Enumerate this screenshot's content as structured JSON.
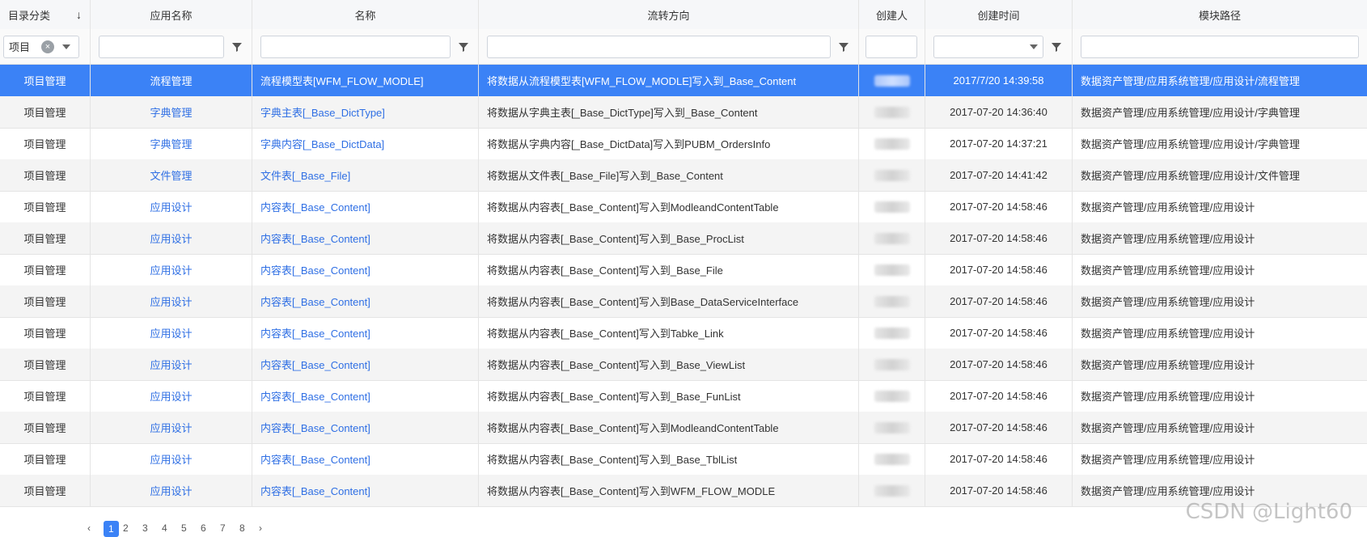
{
  "columns": [
    "目录分类",
    "应用名称",
    "名称",
    "流转方向",
    "创建人",
    "创建时间",
    "模块路径"
  ],
  "filters": {
    "category_tag": "项目",
    "clear_symbol": "×"
  },
  "rows": [
    {
      "cat": "项目管理",
      "app": "流程管理",
      "name": "流程模型表[WFM_FLOW_MODLE]",
      "flow": "将数据从流程模型表[WFM_FLOW_MODLE]写入到_Base_Content",
      "time": "2017/7/20 14:39:58",
      "path": "数据资产管理/应用系统管理/应用设计/流程管理"
    },
    {
      "cat": "项目管理",
      "app": "字典管理",
      "name": "字典主表[_Base_DictType]",
      "flow": "将数据从字典主表[_Base_DictType]写入到_Base_Content",
      "time": "2017-07-20 14:36:40",
      "path": "数据资产管理/应用系统管理/应用设计/字典管理"
    },
    {
      "cat": "项目管理",
      "app": "字典管理",
      "name": "字典内容[_Base_DictData]",
      "flow": "将数据从字典内容[_Base_DictData]写入到PUBM_OrdersInfo",
      "time": "2017-07-20 14:37:21",
      "path": "数据资产管理/应用系统管理/应用设计/字典管理"
    },
    {
      "cat": "项目管理",
      "app": "文件管理",
      "name": "文件表[_Base_File]",
      "flow": "将数据从文件表[_Base_File]写入到_Base_Content",
      "time": "2017-07-20 14:41:42",
      "path": "数据资产管理/应用系统管理/应用设计/文件管理"
    },
    {
      "cat": "项目管理",
      "app": "应用设计",
      "name": "内容表[_Base_Content]",
      "flow": "将数据从内容表[_Base_Content]写入到ModleandContentTable",
      "time": "2017-07-20 14:58:46",
      "path": "数据资产管理/应用系统管理/应用设计"
    },
    {
      "cat": "项目管理",
      "app": "应用设计",
      "name": "内容表[_Base_Content]",
      "flow": "将数据从内容表[_Base_Content]写入到_Base_ProcList",
      "time": "2017-07-20 14:58:46",
      "path": "数据资产管理/应用系统管理/应用设计"
    },
    {
      "cat": "项目管理",
      "app": "应用设计",
      "name": "内容表[_Base_Content]",
      "flow": "将数据从内容表[_Base_Content]写入到_Base_File",
      "time": "2017-07-20 14:58:46",
      "path": "数据资产管理/应用系统管理/应用设计"
    },
    {
      "cat": "项目管理",
      "app": "应用设计",
      "name": "内容表[_Base_Content]",
      "flow": "将数据从内容表[_Base_Content]写入到Base_DataServiceInterface",
      "time": "2017-07-20 14:58:46",
      "path": "数据资产管理/应用系统管理/应用设计"
    },
    {
      "cat": "项目管理",
      "app": "应用设计",
      "name": "内容表[_Base_Content]",
      "flow": "将数据从内容表[_Base_Content]写入到Tabke_Link",
      "time": "2017-07-20 14:58:46",
      "path": "数据资产管理/应用系统管理/应用设计"
    },
    {
      "cat": "项目管理",
      "app": "应用设计",
      "name": "内容表[_Base_Content]",
      "flow": "将数据从内容表[_Base_Content]写入到_Base_ViewList",
      "time": "2017-07-20 14:58:46",
      "path": "数据资产管理/应用系统管理/应用设计"
    },
    {
      "cat": "项目管理",
      "app": "应用设计",
      "name": "内容表[_Base_Content]",
      "flow": "将数据从内容表[_Base_Content]写入到_Base_FunList",
      "time": "2017-07-20 14:58:46",
      "path": "数据资产管理/应用系统管理/应用设计"
    },
    {
      "cat": "项目管理",
      "app": "应用设计",
      "name": "内容表[_Base_Content]",
      "flow": "将数据从内容表[_Base_Content]写入到ModleandContentTable",
      "time": "2017-07-20 14:58:46",
      "path": "数据资产管理/应用系统管理/应用设计"
    },
    {
      "cat": "项目管理",
      "app": "应用设计",
      "name": "内容表[_Base_Content]",
      "flow": "将数据从内容表[_Base_Content]写入到_Base_TblList",
      "time": "2017-07-20 14:58:46",
      "path": "数据资产管理/应用系统管理/应用设计"
    },
    {
      "cat": "项目管理",
      "app": "应用设计",
      "name": "内容表[_Base_Content]",
      "flow": "将数据从内容表[_Base_Content]写入到WFM_FLOW_MODLE",
      "time": "2017-07-20 14:58:46",
      "path": "数据资产管理/应用系统管理/应用设计"
    }
  ],
  "selected_row": 0,
  "pager": {
    "pages": [
      "1",
      "2",
      "3",
      "4",
      "5",
      "6",
      "7",
      "8"
    ],
    "active": "1"
  },
  "watermark": "CSDN @Light60",
  "colors": {
    "selected": "#3b82f6",
    "link": "#2f6fe4"
  }
}
